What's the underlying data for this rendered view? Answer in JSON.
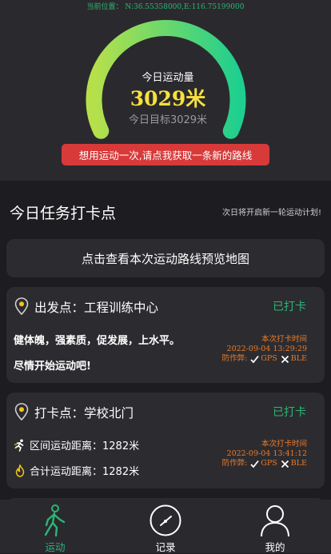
{
  "header": {
    "location": "当前位置：  N:36.55358000,E:116.75199000",
    "today_label": "今日运动量",
    "today_value": "3029米",
    "target": "今日目标3029米",
    "route_button": "想用运动一次,请点我获取一条新的路线",
    "progress": 1.0
  },
  "section": {
    "title": "今日任务打卡点",
    "note": "次日将开启新一轮运动计划!"
  },
  "map_button": "点击查看本次运动路线预览地图",
  "cards": [
    {
      "title": "出发点：工程训练中心",
      "status": "已打卡",
      "line1": "健体魄，强素质，促发展，上水平。",
      "line2": "尽情开始运动吧!",
      "checkin_label": "本次打卡时间",
      "checkin_time": "2022-09-04 13:29:29",
      "anti_label": "防作弊:",
      "gps": "GPS",
      "ble": "BLE"
    },
    {
      "title": "打卡点：学校北门",
      "status": "已打卡",
      "stat1": "区间运动距离：1282米",
      "stat2": "合计运动距离：1282米",
      "checkin_label": "本次打卡时间",
      "checkin_time": "2022-09-04 13:41:12",
      "anti_label": "防作弊:",
      "gps": "GPS",
      "ble": "BLE"
    }
  ],
  "nav": {
    "items": [
      {
        "label": "运动",
        "icon": "running-person-icon",
        "active": true
      },
      {
        "label": "记录",
        "icon": "clock-icon",
        "active": false
      },
      {
        "label": "我的",
        "icon": "user-icon",
        "active": false
      }
    ]
  },
  "colors": {
    "accent_green": "#2bb673",
    "value_yellow": "#f9e03c",
    "button_red": "#d83a3a",
    "checkin_orange": "#ec7a2a",
    "gauge_gradient": [
      "#b6e04a",
      "#1fcf8f"
    ]
  }
}
